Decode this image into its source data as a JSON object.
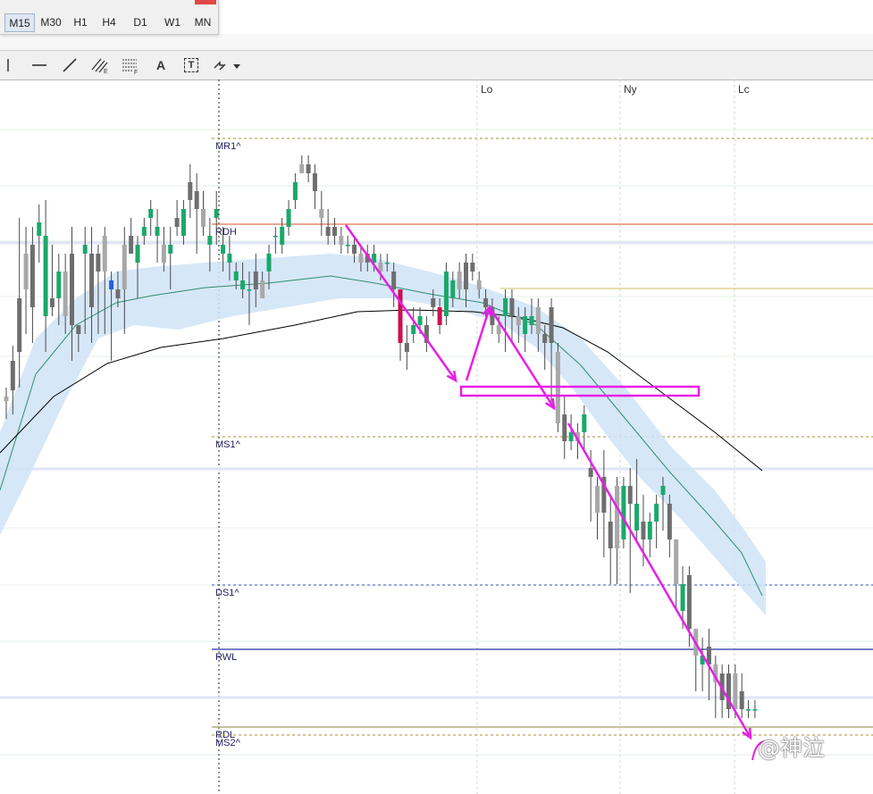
{
  "timeframes": [
    "M15",
    "M30",
    "H1",
    "H4",
    "D1",
    "W1",
    "MN"
  ],
  "active_timeframe": "M15",
  "toolbar": {
    "tools": [
      "vertical-line-icon",
      "horizontal-line-icon",
      "trendline-icon",
      "fibonacci-channel-icon",
      "fibonacci-levels-icon",
      "text-icon",
      "text-label-icon",
      "arrows-icon"
    ],
    "text_tool_label": "A",
    "label_tool_label": "T"
  },
  "watermark": "@神泣",
  "colors": {
    "bull": "#1aa86a",
    "bull_blue": "#2a5fd0",
    "bear_gray": "#6e6e6e",
    "bear_light": "#a8a8a8",
    "bear_red": "#cc1155",
    "annotation": "#e81ee8",
    "band": "#cfe3f7",
    "ema_fast": "#2f8f6f",
    "ema_slow": "#000000"
  },
  "chart_data": {
    "type": "candlestick",
    "session_labels": [
      "Lo",
      "Ny",
      "Lc"
    ],
    "levels": [
      {
        "label": "MR1^",
        "style": "dashed",
        "color": "#a09030"
      },
      {
        "label": "RDH",
        "style": "solid",
        "color": "#e07050"
      },
      {
        "label": "MS1^",
        "style": "dashed",
        "color": "#a09030"
      },
      {
        "label": "DS1^",
        "style": "dashed",
        "color": "#3050c0"
      },
      {
        "label": "RWL",
        "style": "solid",
        "color": "#2030a0"
      },
      {
        "label": "RDL",
        "style": "solid",
        "color": "#a0a060"
      },
      {
        "label": "MS2^",
        "style": "dashed",
        "color": "#a09030"
      }
    ],
    "candles": [
      [
        0.4,
        0.35,
        0.5,
        0.15
      ],
      [
        0.8,
        0.47,
        0.97,
        0.2
      ],
      [
        1.5,
        0.9,
        2.4,
        0.5
      ],
      [
        2.0,
        1.6,
        2.3,
        1.1
      ],
      [
        2.1,
        1.4,
        2.3,
        1.0
      ],
      [
        2.2,
        2.35,
        2.55,
        1.9
      ],
      [
        1.3,
        2.2,
        2.6,
        0.9
      ],
      [
        1.5,
        1.4,
        2.1,
        1.3
      ],
      [
        1.5,
        1.8,
        2.0,
        1.2
      ],
      [
        1.8,
        1.3,
        2.0,
        1.1
      ],
      [
        2.0,
        1.2,
        2.3,
        0.8
      ],
      [
        1.2,
        1.1,
        1.2,
        0.9
      ],
      [
        2.0,
        2.1,
        2.3,
        1.1
      ],
      [
        2.0,
        1.4,
        2.3,
        1.0
      ],
      [
        2.0,
        1.8,
        2.1,
        1.1
      ],
      [
        2.2,
        1.8,
        2.3,
        1.1
      ],
      [
        1.6,
        1.7,
        1.8,
        0.8
      ],
      [
        1.6,
        1.5,
        1.8,
        1.4
      ],
      [
        2.1,
        1.6,
        2.3,
        1.1
      ],
      [
        2.2,
        2.0,
        2.4,
        2.0
      ],
      [
        1.9,
        2.1,
        2.2,
        1.5
      ],
      [
        2.2,
        2.3,
        2.4,
        2.1
      ],
      [
        2.4,
        2.5,
        2.6,
        2.2
      ],
      [
        2.2,
        2.3,
        2.5,
        1.9
      ],
      [
        2.1,
        1.9,
        2.3,
        1.8
      ],
      [
        2.0,
        2.1,
        2.3,
        1.6
      ],
      [
        2.4,
        2.3,
        2.6,
        2.2
      ],
      [
        2.2,
        2.5,
        2.6,
        2.1
      ],
      [
        2.8,
        2.6,
        3.0,
        2.4
      ],
      [
        2.7,
        2.5,
        2.9,
        2.0
      ],
      [
        2.5,
        2.3,
        2.7,
        2.2
      ],
      [
        2.1,
        2.2,
        2.4,
        1.8
      ],
      [
        2.4,
        2.5,
        2.7,
        2.1
      ],
      [
        2.0,
        2.1,
        2.3,
        1.8
      ],
      [
        1.9,
        2.0,
        2.2,
        1.7
      ],
      [
        1.7,
        1.8,
        1.9,
        1.6
      ],
      [
        1.6,
        1.7,
        1.9,
        1.5
      ],
      [
        1.6,
        1.6,
        1.8,
        1.2
      ],
      [
        1.8,
        1.6,
        2.0,
        1.4
      ],
      [
        1.7,
        1.5,
        1.8,
        1.5
      ],
      [
        1.8,
        2.0,
        2.1,
        1.6
      ],
      [
        2.2,
        2.2,
        2.3,
        2.0
      ],
      [
        2.1,
        2.3,
        2.4,
        2.0
      ],
      [
        2.3,
        2.5,
        2.6,
        2.2
      ],
      [
        2.6,
        2.8,
        2.9,
        2.5
      ],
      [
        3.0,
        2.9,
        3.1,
        2.9
      ],
      [
        3.0,
        2.9,
        3.1,
        2.8
      ],
      [
        2.9,
        2.7,
        3.0,
        2.5
      ],
      [
        2.5,
        2.4,
        2.7,
        2.2
      ],
      [
        2.3,
        2.2,
        2.5,
        2.1
      ],
      [
        2.3,
        2.2,
        2.4,
        2.1
      ],
      [
        2.2,
        2.1,
        2.3,
        2.0
      ],
      [
        2.1,
        2.1,
        2.2,
        2.0
      ],
      [
        2.1,
        2.0,
        2.2,
        1.9
      ],
      [
        2.0,
        1.9,
        2.1,
        1.8
      ],
      [
        2.0,
        1.9,
        2.1,
        1.8
      ],
      [
        1.9,
        2.0,
        2.1,
        1.8
      ],
      [
        1.9,
        1.8,
        2.0,
        1.7
      ],
      [
        1.9,
        1.9,
        2.0,
        1.8
      ],
      [
        1.8,
        1.6,
        1.9,
        1.4
      ],
      [
        1.6,
        1.0,
        1.6,
        0.8
      ],
      [
        1.0,
        0.9,
        1.2,
        0.7
      ],
      [
        1.1,
        1.2,
        1.4,
        1.0
      ],
      [
        1.2,
        1.3,
        1.4,
        1.1
      ],
      [
        1.2,
        1.0,
        1.3,
        0.9
      ],
      [
        1.5,
        1.4,
        1.6,
        1.3
      ],
      [
        1.4,
        1.2,
        1.5,
        1.1
      ],
      [
        1.3,
        1.8,
        1.9,
        1.2
      ],
      [
        1.5,
        1.7,
        1.8,
        1.4
      ],
      [
        1.8,
        1.6,
        1.9,
        1.5
      ],
      [
        1.9,
        1.6,
        2.0,
        1.4
      ],
      [
        1.9,
        1.8,
        2.0,
        1.7
      ],
      [
        1.7,
        1.6,
        1.8,
        1.5
      ],
      [
        1.5,
        1.4,
        1.6,
        1.3
      ],
      [
        1.4,
        1.2,
        1.5,
        1.1
      ],
      [
        1.2,
        1.1,
        1.3,
        1.0
      ],
      [
        1.3,
        1.5,
        1.6,
        0.9
      ],
      [
        1.5,
        1.3,
        1.6,
        1.0
      ],
      [
        1.3,
        1.2,
        1.4,
        1.0
      ],
      [
        1.1,
        1.3,
        1.4,
        0.9
      ],
      [
        1.2,
        1.3,
        1.5,
        1.1
      ],
      [
        1.4,
        1.1,
        1.5,
        0.9
      ],
      [
        1.1,
        1.0,
        1.2,
        0.7
      ],
      [
        1.4,
        1.0,
        1.5,
        0.3
      ],
      [
        0.9,
        0.1,
        1.0,
        0.0
      ],
      [
        0.2,
        -0.1,
        0.4,
        -0.3
      ],
      [
        -0.1,
        0.0,
        0.2,
        -0.2
      ],
      [
        0.0,
        -0.1,
        0.1,
        -0.3
      ],
      [
        0.0,
        0.2,
        0.3,
        -0.2
      ],
      [
        -0.4,
        -0.5,
        -0.2,
        -1.0
      ],
      [
        -0.6,
        -0.9,
        -0.5,
        -1.2
      ],
      [
        -0.5,
        -0.9,
        -0.2,
        -1.4
      ],
      [
        -1.0,
        -1.3,
        -0.7,
        -1.7
      ],
      [
        -0.6,
        -1.3,
        -0.5,
        -1.7
      ],
      [
        -1.2,
        -0.6,
        -0.5,
        -1.3
      ],
      [
        -0.6,
        -0.8,
        -0.4,
        -1.8
      ],
      [
        -1.1,
        -0.8,
        -0.3,
        -1.2
      ],
      [
        -1.0,
        -1.2,
        -0.7,
        -1.5
      ],
      [
        -1.2,
        -1.0,
        -0.9,
        -1.4
      ],
      [
        -1.0,
        -0.8,
        -0.7,
        -1.3
      ],
      [
        -0.7,
        -0.6,
        -0.5,
        -1.1
      ],
      [
        -0.8,
        -1.2,
        -0.7,
        -1.4
      ],
      [
        -1.2,
        -1.7,
        -1.2,
        -2.0
      ],
      [
        -2.0,
        -1.7,
        -1.5,
        -2.2
      ],
      [
        -1.6,
        -2.2,
        -1.5,
        -2.4
      ],
      [
        -2.2,
        -2.5,
        -2.2,
        -2.9
      ],
      [
        -2.6,
        -2.5,
        -2.3,
        -2.9
      ],
      [
        -2.4,
        -2.6,
        -2.2,
        -3.0
      ],
      [
        -2.6,
        -2.8,
        -2.5,
        -3.2
      ],
      [
        -2.7,
        -3.0,
        -2.6,
        -3.2
      ],
      [
        -2.7,
        -3.1,
        -2.6,
        -3.2
      ],
      [
        -2.7,
        -3.1,
        -2.6,
        -3.2
      ],
      [
        -2.9,
        -3.1,
        -2.7,
        -3.2
      ],
      [
        -3.1,
        -3.1,
        -3.0,
        -3.2
      ],
      [
        -3.1,
        -3.1,
        -3.0,
        -3.2
      ]
    ]
  }
}
